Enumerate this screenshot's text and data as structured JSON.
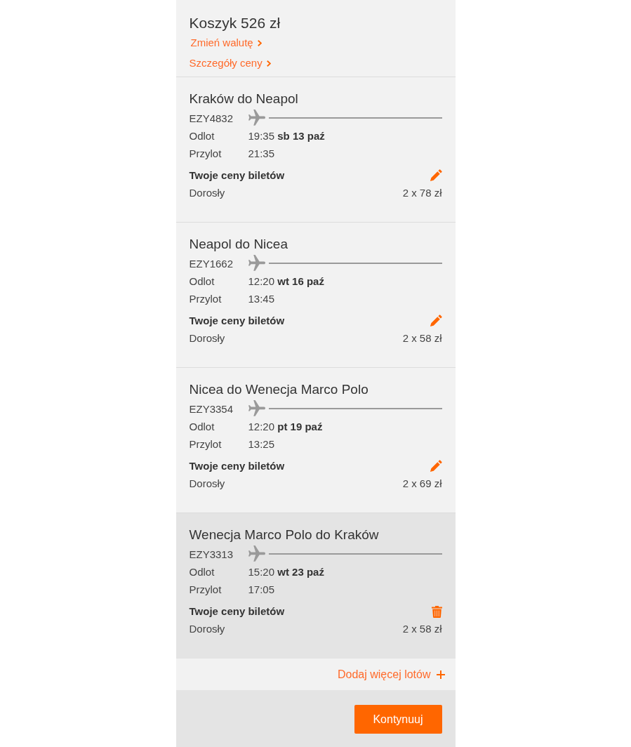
{
  "cart": {
    "title": "Koszyk 526 zł",
    "links": [
      {
        "label": "Zmień walutę"
      },
      {
        "label": "Szczegóły ceny"
      }
    ]
  },
  "flights": [
    {
      "kind": "edit",
      "route": "Kraków do Neapol",
      "flight_number": "EZY4832",
      "departure_label": "Odlot",
      "departure": "19:35 **sb 13 paź**",
      "arrival_label": "Przylot",
      "arrival": "21:35",
      "prices_heading": "Twoje ceny biletów",
      "passenger": "Dorosły",
      "price": "2 x 78 zł",
      "highlighted": false
    },
    {
      "kind": "edit",
      "route": "Neapol do Nicea",
      "flight_number": "EZY1662",
      "departure_label": "Odlot",
      "departure": "12:20 **wt 16 paź**",
      "arrival_label": "Przylot",
      "arrival": "13:45",
      "prices_heading": "Twoje ceny biletów",
      "passenger": "Dorosły",
      "price": "2 x 58 zł",
      "highlighted": false
    },
    {
      "kind": "edit",
      "route": "Nicea do Wenecja Marco Polo",
      "flight_number": "EZY3354",
      "departure_label": "Odlot",
      "departure": "12:20 **pt 19 paź**",
      "arrival_label": "Przylot",
      "arrival": "13:25",
      "prices_heading": "Twoje ceny biletów",
      "passenger": "Dorosły",
      "price": "2 x 69 zł",
      "highlighted": false
    },
    {
      "kind": "delete",
      "route": "Wenecja Marco Polo do Kraków",
      "flight_number": "EZY3313",
      "departure_label": "Odlot",
      "departure": "15:20 **wt 23 paź**",
      "arrival_label": "Przylot",
      "arrival": "17:05",
      "prices_heading": "Twoje ceny biletów",
      "passenger": "Dorosły",
      "price": "2 x 58 zł",
      "highlighted": true
    }
  ],
  "add_more": {
    "label": "Dodaj więcej lotów"
  },
  "continue_button": {
    "label": "Kontynuuj"
  }
}
